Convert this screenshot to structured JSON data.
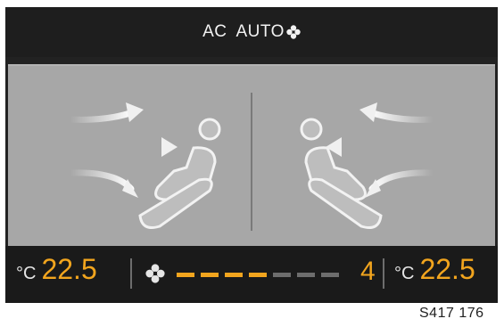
{
  "header": {
    "ac_label": "AC",
    "auto_label": "AUTO",
    "fan_icon": "fan-icon"
  },
  "diagram": {
    "left_icon": "seat-occupant-icon",
    "right_icon": "seat-occupant-icon",
    "airflow_icon": "airflow-arrows-icon"
  },
  "footer": {
    "left_temp_unit": "°C",
    "left_temp_value": "22.5",
    "fan_icon": "fan-icon",
    "fan_level": "4",
    "fan_segments_total": 7,
    "fan_segments_active": 4,
    "right_temp_unit": "°C",
    "right_temp_value": "22.5"
  },
  "caption": "S417 176",
  "colors": {
    "accent": "#f2a51e",
    "inactive_segment": "#6d6d6d",
    "panel": "#a7a7a7",
    "bar": "#1e1e1e"
  }
}
